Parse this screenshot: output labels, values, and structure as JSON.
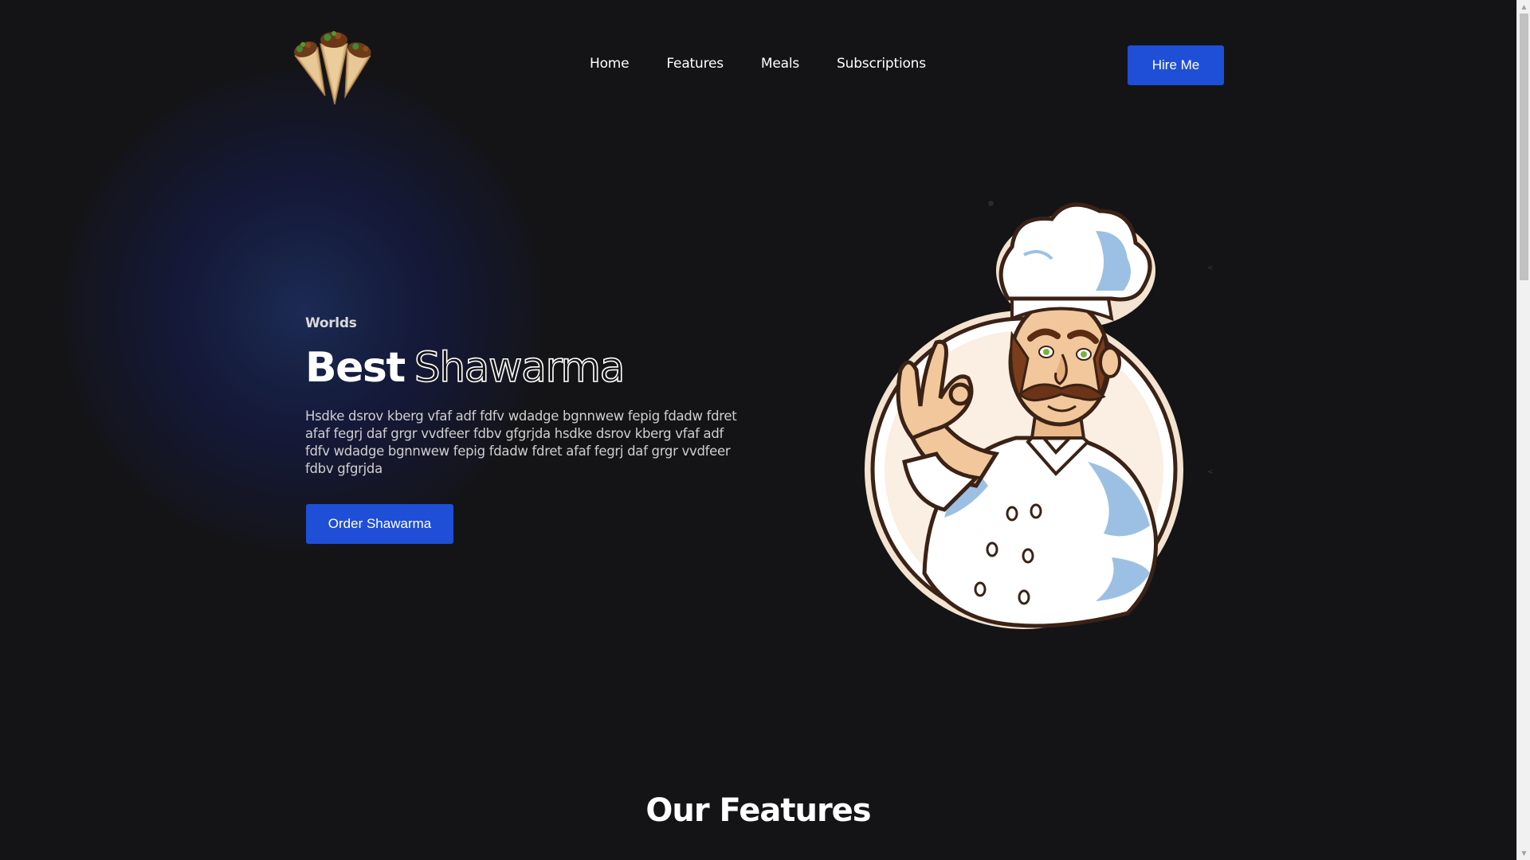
{
  "nav": {
    "logo_alt": "shawarma-logo",
    "links": [
      {
        "label": "Home"
      },
      {
        "label": "Features"
      },
      {
        "label": "Meals"
      },
      {
        "label": "Subscriptions"
      }
    ],
    "hire_label": "Hire Me"
  },
  "hero": {
    "eyebrow": "Worlds",
    "headline_solid": "Best",
    "headline_outline": "Shawarma",
    "description": "Hsdke dsrov kberg vfaf adf fdfv wdadge bgnnwew fepig fdadw fdret afaf fegrj daf grgr vvdfeer fdbv gfgrjda hsdke dsrov kberg vfaf adf fdfv wdadge bgnnwew fepig fdadw fdret afaf fegrj daf grgr vvdfeer fdbv gfgrjda",
    "order_label": "Order Shawarma",
    "illustration": "chef-illustration"
  },
  "features": {
    "title": "Our Features"
  },
  "colors": {
    "background": "#141417",
    "accent": "#1f4fd6",
    "text": "#ffffff"
  }
}
